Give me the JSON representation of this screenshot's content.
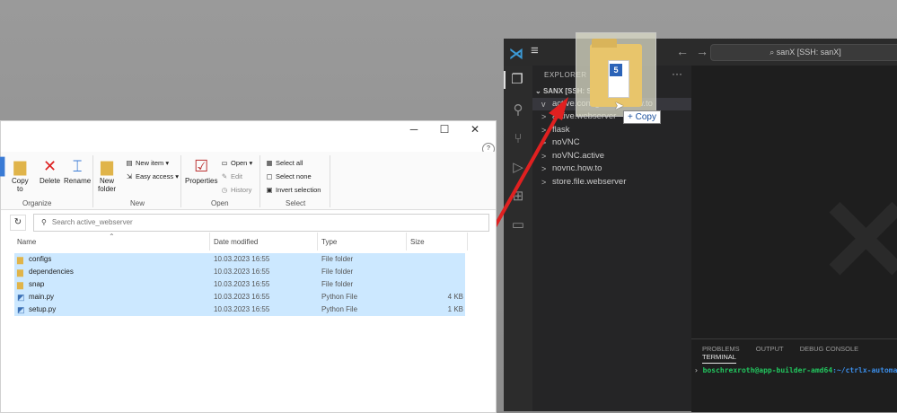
{
  "vscode": {
    "search_text": "sanX [SSH: sanX]",
    "explorer_title": "EXPLORER",
    "more_label": "···",
    "root_label": "SANX [SSH: SANX]",
    "tree": [
      {
        "chevron": "v",
        "label": "active.configuration.how.to",
        "selected": true
      },
      {
        "chevron": ">",
        "label": "active.webserver"
      },
      {
        "chevron": ">",
        "label": "flask"
      },
      {
        "chevron": ">",
        "label": "noVNC"
      },
      {
        "chevron": ">",
        "label": "noVNC.active"
      },
      {
        "chevron": ">",
        "label": "novnc.how.to"
      },
      {
        "chevron": ">",
        "label": "store.file.webserver"
      }
    ],
    "panel_tabs": [
      "PROBLEMS",
      "OUTPUT",
      "DEBUG CONSOLE",
      "TERMINAL"
    ],
    "active_panel_tab": "TERMINAL",
    "terminal_user": "boschrexroth@app-builder-amd64",
    "terminal_path": ":~/ctrlx-automat"
  },
  "drag": {
    "copy_label": "+ Copy"
  },
  "explorer": {
    "ribbon": {
      "copy_to": "Copy\nto",
      "delete": "Delete",
      "rename": "Rename",
      "new_folder": "New\nfolder",
      "new_item": "New item",
      "easy_access": "Easy access",
      "properties": "Properties",
      "open": "Open",
      "edit": "Edit",
      "history": "History",
      "select_all": "Select all",
      "select_none": "Select none",
      "invert_selection": "Invert selection",
      "groups": [
        "Organize",
        "New",
        "Open",
        "Select"
      ]
    },
    "search_placeholder": "Search active_webserver",
    "columns": [
      "Name",
      "Date modified",
      "Type",
      "Size"
    ],
    "files": [
      {
        "name": "configs",
        "date": "10.03.2023 16:55",
        "type": "File folder",
        "size": "",
        "kind": "folder"
      },
      {
        "name": "dependencies",
        "date": "10.03.2023 16:55",
        "type": "File folder",
        "size": "",
        "kind": "folder"
      },
      {
        "name": "snap",
        "date": "10.03.2023 16:55",
        "type": "File folder",
        "size": "",
        "kind": "folder"
      },
      {
        "name": "main.py",
        "date": "10.03.2023 16:55",
        "type": "Python File",
        "size": "4 KB",
        "kind": "python"
      },
      {
        "name": "setup.py",
        "date": "10.03.2023 16:55",
        "type": "Python File",
        "size": "1 KB",
        "kind": "python"
      }
    ]
  },
  "colors": {
    "selection": "#cce8ff",
    "arrow": "#e02020",
    "terminal_user": "#22c55e",
    "terminal_path": "#3b8eea"
  }
}
